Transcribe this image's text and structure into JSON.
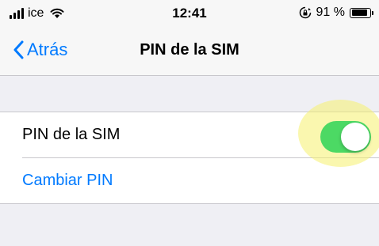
{
  "status_bar": {
    "carrier": "ice",
    "time": "12:41",
    "battery_percent": "91 %",
    "battery_level": 0.91,
    "icons": [
      "signal-icon",
      "wifi-icon",
      "orientation-lock-icon",
      "battery-icon"
    ]
  },
  "nav": {
    "back_label": "Atrás",
    "title": "PIN de la SIM"
  },
  "settings": {
    "sim_pin_label": "PIN de la SIM",
    "sim_pin_enabled": true,
    "change_pin_label": "Cambiar PIN"
  },
  "colors": {
    "accent": "#007aff",
    "toggle_on": "#4cd964",
    "highlight": "#f5f06e",
    "background": "#efeff4"
  }
}
